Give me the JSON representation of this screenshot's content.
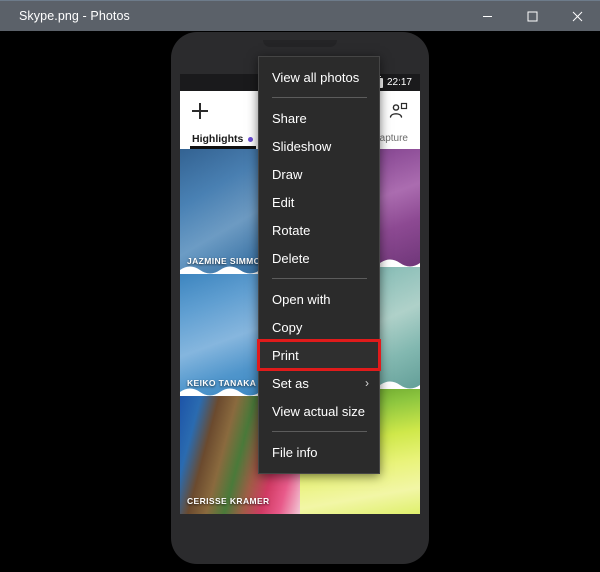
{
  "window": {
    "title": "Skype.png - Photos",
    "controls": [
      {
        "name": "minimize",
        "label": "–"
      },
      {
        "name": "maximize",
        "label": "□"
      },
      {
        "name": "close",
        "label": "✕"
      }
    ]
  },
  "context_menu": {
    "items": [
      {
        "label": "View all photos",
        "type": "item",
        "highlighted": false,
        "submenu": false
      },
      {
        "label": "",
        "type": "separator"
      },
      {
        "label": "Share",
        "type": "item",
        "highlighted": false,
        "submenu": false
      },
      {
        "label": "Slideshow",
        "type": "item",
        "highlighted": false,
        "submenu": false
      },
      {
        "label": "Draw",
        "type": "item",
        "highlighted": false,
        "submenu": false
      },
      {
        "label": "Edit",
        "type": "item",
        "highlighted": false,
        "submenu": false
      },
      {
        "label": "Rotate",
        "type": "item",
        "highlighted": false,
        "submenu": false
      },
      {
        "label": "Delete",
        "type": "item",
        "highlighted": false,
        "submenu": false
      },
      {
        "label": "",
        "type": "separator"
      },
      {
        "label": "Open with",
        "type": "item",
        "highlighted": false,
        "submenu": false
      },
      {
        "label": "Copy",
        "type": "item",
        "highlighted": false,
        "submenu": false
      },
      {
        "label": "Print",
        "type": "item",
        "highlighted": true,
        "submenu": false
      },
      {
        "label": "Set as",
        "type": "item",
        "highlighted": false,
        "submenu": true,
        "submenu_glyph": "›"
      },
      {
        "label": "View actual size",
        "type": "item",
        "highlighted": false,
        "submenu": false
      },
      {
        "label": "",
        "type": "separator"
      },
      {
        "label": "File info",
        "type": "item",
        "highlighted": false,
        "submenu": false
      }
    ],
    "highlight_color": "#e01b1b",
    "background_color": "#2b2b2b"
  },
  "photo": {
    "phone": {
      "status_bar": {
        "time": "22:17",
        "battery_icon": "battery-icon"
      },
      "app_header": {
        "add_icon": "plus-icon",
        "person_add_icon": "person-add-icon",
        "tab_highlights": "Highlights",
        "tab_capture": "Capture",
        "highlights_dot_color": "#6a4bd6"
      },
      "gallery": {
        "left_column": [
          {
            "name": "JAZMINE SIMMONS"
          },
          {
            "name": "KEIKO TANAKA"
          },
          {
            "name": "CERISSE KRAMER"
          }
        ],
        "right_column": [
          {
            "name": ""
          },
          {
            "name": ""
          },
          {
            "name": ""
          }
        ]
      }
    }
  }
}
